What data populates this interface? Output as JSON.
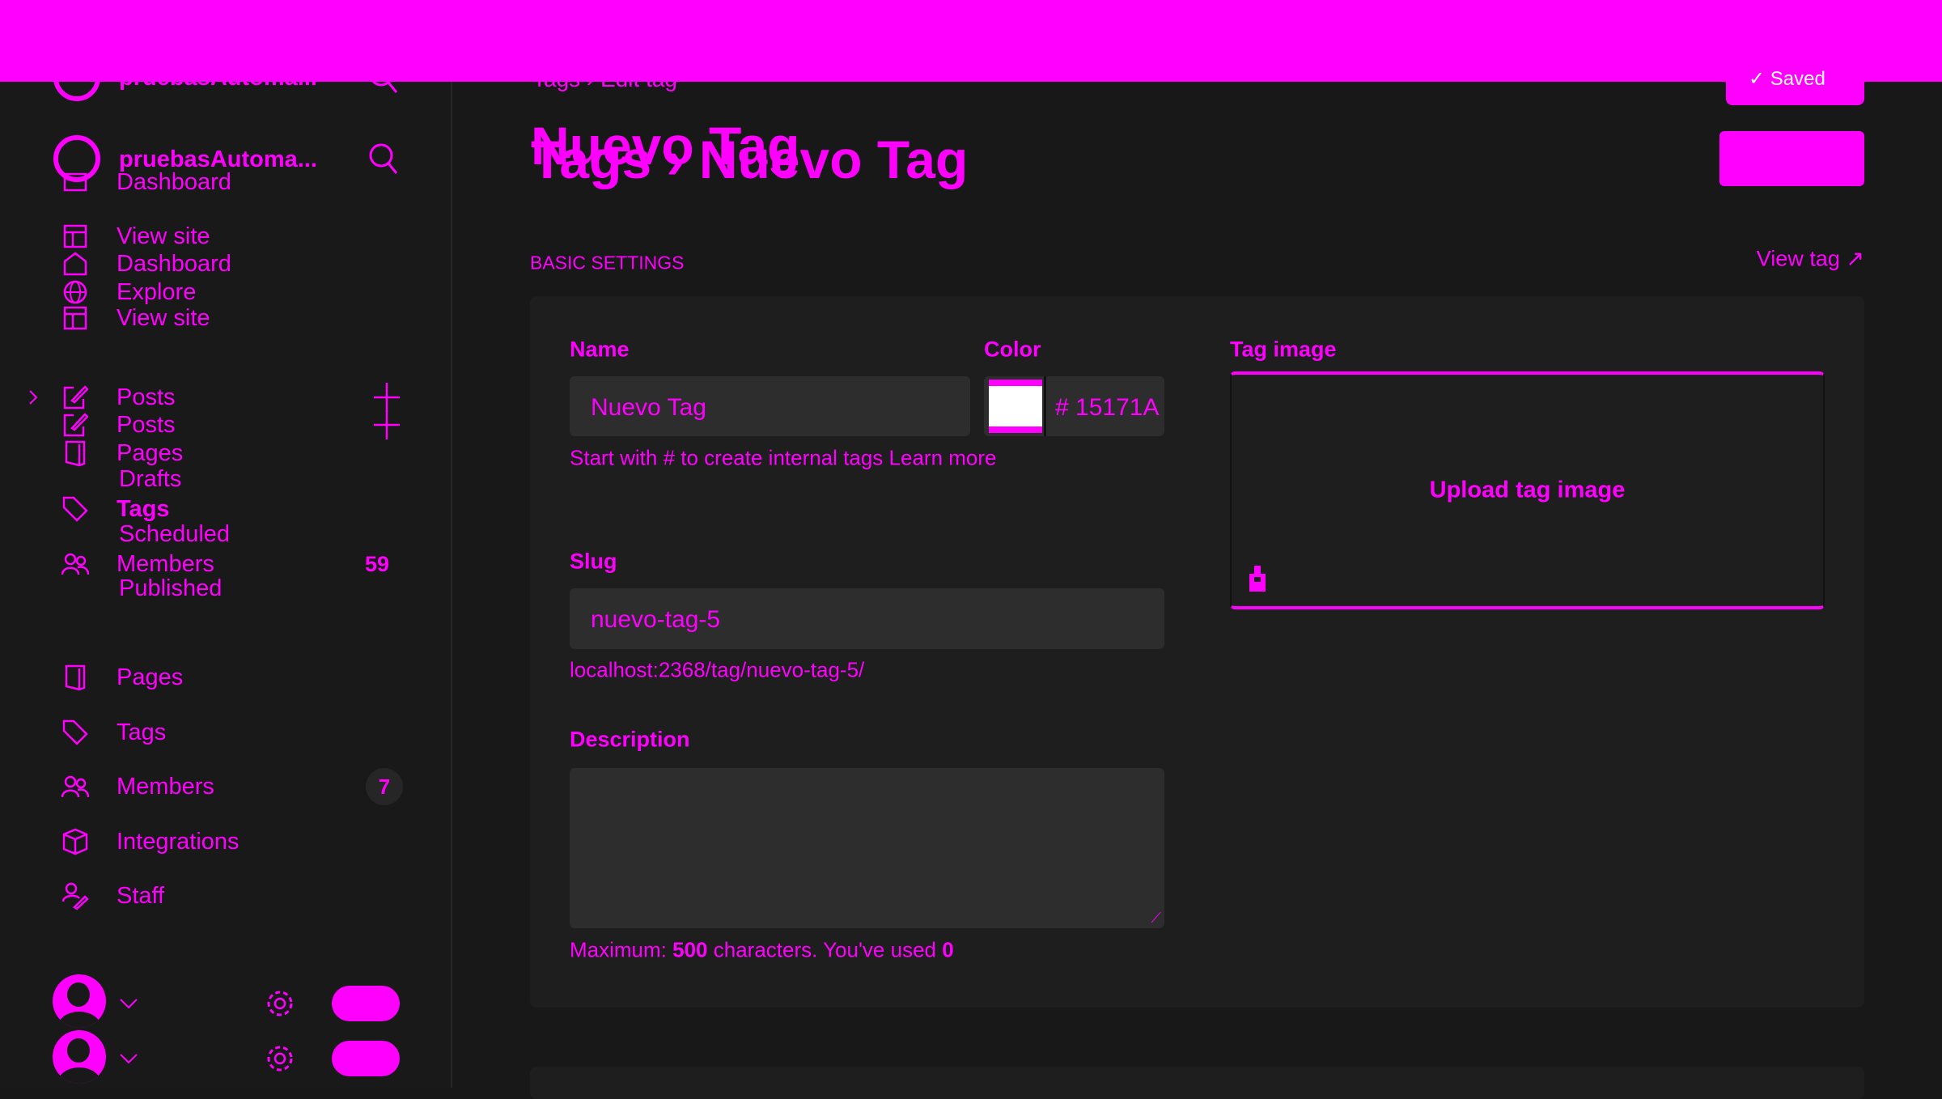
{
  "colors": {
    "accent": "#ff00ff",
    "sidebar_bg": "#191919",
    "main_bg": "#181818",
    "card_bg": "#1e1e1e",
    "input_bg": "#2d2d2d"
  },
  "sidebar": {
    "site_name": "pruebasAutoma...",
    "site_name_2": "pruebasAutoma...",
    "ghost_dashboard": "Dashboard",
    "top_items": [
      {
        "label": "View site",
        "icon": "layout-icon"
      },
      {
        "label": "Dashboard",
        "icon": "home-icon"
      },
      {
        "label": "Explore",
        "icon": "globe-icon"
      },
      {
        "label": "View site",
        "icon": "layout-icon"
      }
    ],
    "posts": "Posts",
    "posts_2": "Posts",
    "pages_overlay": "Pages",
    "drafts": "Drafts",
    "tags_overlay": "Tags",
    "scheduled": "Scheduled",
    "members_overlay": "Members",
    "members_count": "59",
    "published": "Published",
    "items": [
      {
        "label": "Pages"
      },
      {
        "label": "Tags"
      },
      {
        "label": "Members",
        "badge": "7"
      },
      {
        "label": "Integrations"
      },
      {
        "label": "Staff"
      }
    ]
  },
  "header": {
    "breadcrumb_parent": "Tags",
    "breadcrumb_current": "Edit tag",
    "title": "Nuevo Tag",
    "title_parent": "Tags",
    "title_current": "Nuevo Tag",
    "saved_label": "Saved"
  },
  "section": {
    "title": "BASIC SETTINGS",
    "view_tag": "View tag"
  },
  "form": {
    "name_label": "Name",
    "name_value": "Nuevo Tag",
    "name_hint": "Start with # to create internal tags Learn more",
    "color_label": "Color",
    "color_hash": "#",
    "color_value": "15171A",
    "slug_label": "Slug",
    "slug_value": "nuevo-tag-5",
    "slug_url": "localhost:2368/tag/nuevo-tag-5/",
    "description_label": "Description",
    "description_value": "",
    "counter_prefix": "Maximum: ",
    "counter_max": "500",
    "counter_mid": " characters. You've used ",
    "counter_used": "0",
    "image_label": "Tag image",
    "upload_label": "Upload tag image"
  }
}
